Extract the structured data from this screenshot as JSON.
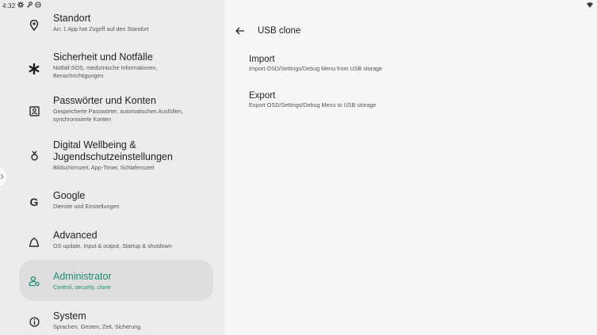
{
  "status_bar": {
    "time": "4:32",
    "icons": [
      "settings-icon",
      "wrench-icon",
      "vpn-icon"
    ],
    "wifi_icon": "wifi-icon"
  },
  "accent_color": "#1d8e72",
  "sidebar": {
    "items": [
      {
        "title": "Standort",
        "subtitle": "An: 1 App hat Zugriff auf den Standort",
        "icon": "location-icon"
      },
      {
        "title": "Sicherheit und Notfälle",
        "subtitle": "Notfall-SOS, medizinische Informationen, Benachrichtigungen",
        "icon": "asterisk-icon"
      },
      {
        "title": "Passwörter und Konten",
        "subtitle": "Gespeicherte Passwörter, automatisches Ausfüllen, synchronisierte Konten",
        "icon": "account-box-icon"
      },
      {
        "title": "Digital Wellbeing & Jugendschutzeinstellungen",
        "subtitle": "Bildschirmzeit, App-Timer, Schlafenszeit",
        "icon": "wellbeing-icon"
      },
      {
        "title": "Google",
        "subtitle": "Dienste und Einstellungen",
        "icon": "google-icon"
      },
      {
        "title": "Advanced",
        "subtitle": "OS update, Input & output, Startup & shutdown",
        "icon": "home-outline-icon"
      },
      {
        "title": "Administrator",
        "subtitle": "Control, security, clone",
        "icon": "admin-icon",
        "selected": true
      },
      {
        "title": "System",
        "subtitle": "Sprachen, Gesten, Zeit, Sicherung",
        "icon": "info-icon"
      }
    ]
  },
  "detail": {
    "title": "USB clone",
    "options": [
      {
        "title": "Import",
        "subtitle": "Import OSD/Settings/Debug Menu from USB storage"
      },
      {
        "title": "Export",
        "subtitle": "Export OSD/Settings/Debug Menu to USB storage"
      }
    ]
  }
}
